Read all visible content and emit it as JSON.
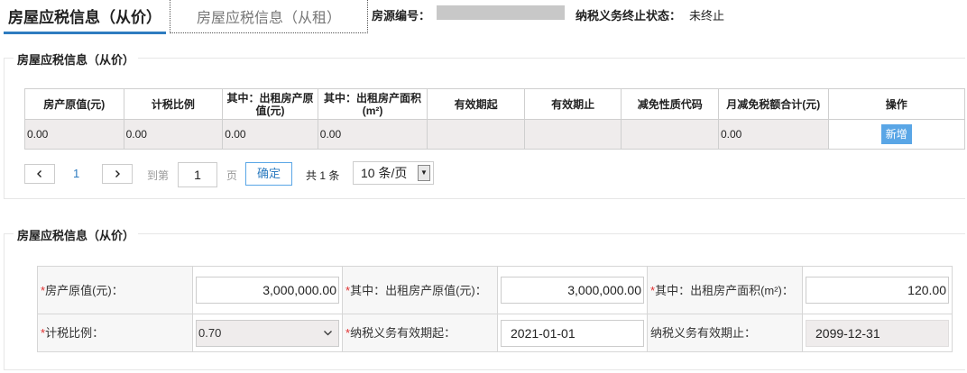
{
  "tabs": [
    {
      "label": "房屋应税信息（从价）",
      "active": true
    },
    {
      "label": "房屋应税信息（从租）",
      "active": false
    }
  ],
  "header": {
    "property_no_label": "房源编号：",
    "tax_status_label": "纳税义务终止状态：",
    "tax_status_value": "未终止"
  },
  "section1": {
    "title": "房屋应税信息（从价）",
    "columns": [
      "房产原值(元)",
      "计税比例",
      "其中：出租房产原值(元)",
      "其中：出租房产面积(m²)",
      "有效期起",
      "有效期止",
      "减免性质代码",
      "月减免税额合计(元)",
      "操作"
    ],
    "rows": [
      {
        "cells": [
          "0.00",
          "0.00",
          "0.00",
          "0.00",
          "",
          "",
          "",
          "0.00"
        ],
        "action": "新增"
      }
    ],
    "pager": {
      "current": "1",
      "goto_label": "到第",
      "page_unit": "页",
      "page_input": "1",
      "confirm": "确定",
      "total": "共 1 条",
      "page_size": "10 条/页"
    }
  },
  "section2": {
    "title": "房屋应税信息（从价）",
    "fields": {
      "original_value": {
        "label": "房产原值(元)：",
        "value": "3,000,000.00",
        "required": true
      },
      "rent_original_value": {
        "label": "其中：出租房产原值(元)：",
        "value": "3,000,000.00",
        "required": true
      },
      "rent_area": {
        "label": "其中：出租房产面积(m²)：",
        "value": "120.00",
        "required": true
      },
      "tax_ratio": {
        "label": "计税比例：",
        "value": "0.70",
        "required": true
      },
      "start_date": {
        "label": "纳税义务有效期起：",
        "value": "2021-01-01",
        "required": true
      },
      "end_date": {
        "label": "纳税义务有效期止：",
        "value": "2099-12-31",
        "required": false
      }
    }
  },
  "colors": {
    "accent": "#2e7cc0",
    "button": "#5aa6e6",
    "required": "#e03030",
    "mask": "#c8c8c8"
  },
  "icons": {
    "prev": "chevron-left-icon",
    "next": "chevron-right-icon",
    "select": "chevron-down-icon"
  }
}
